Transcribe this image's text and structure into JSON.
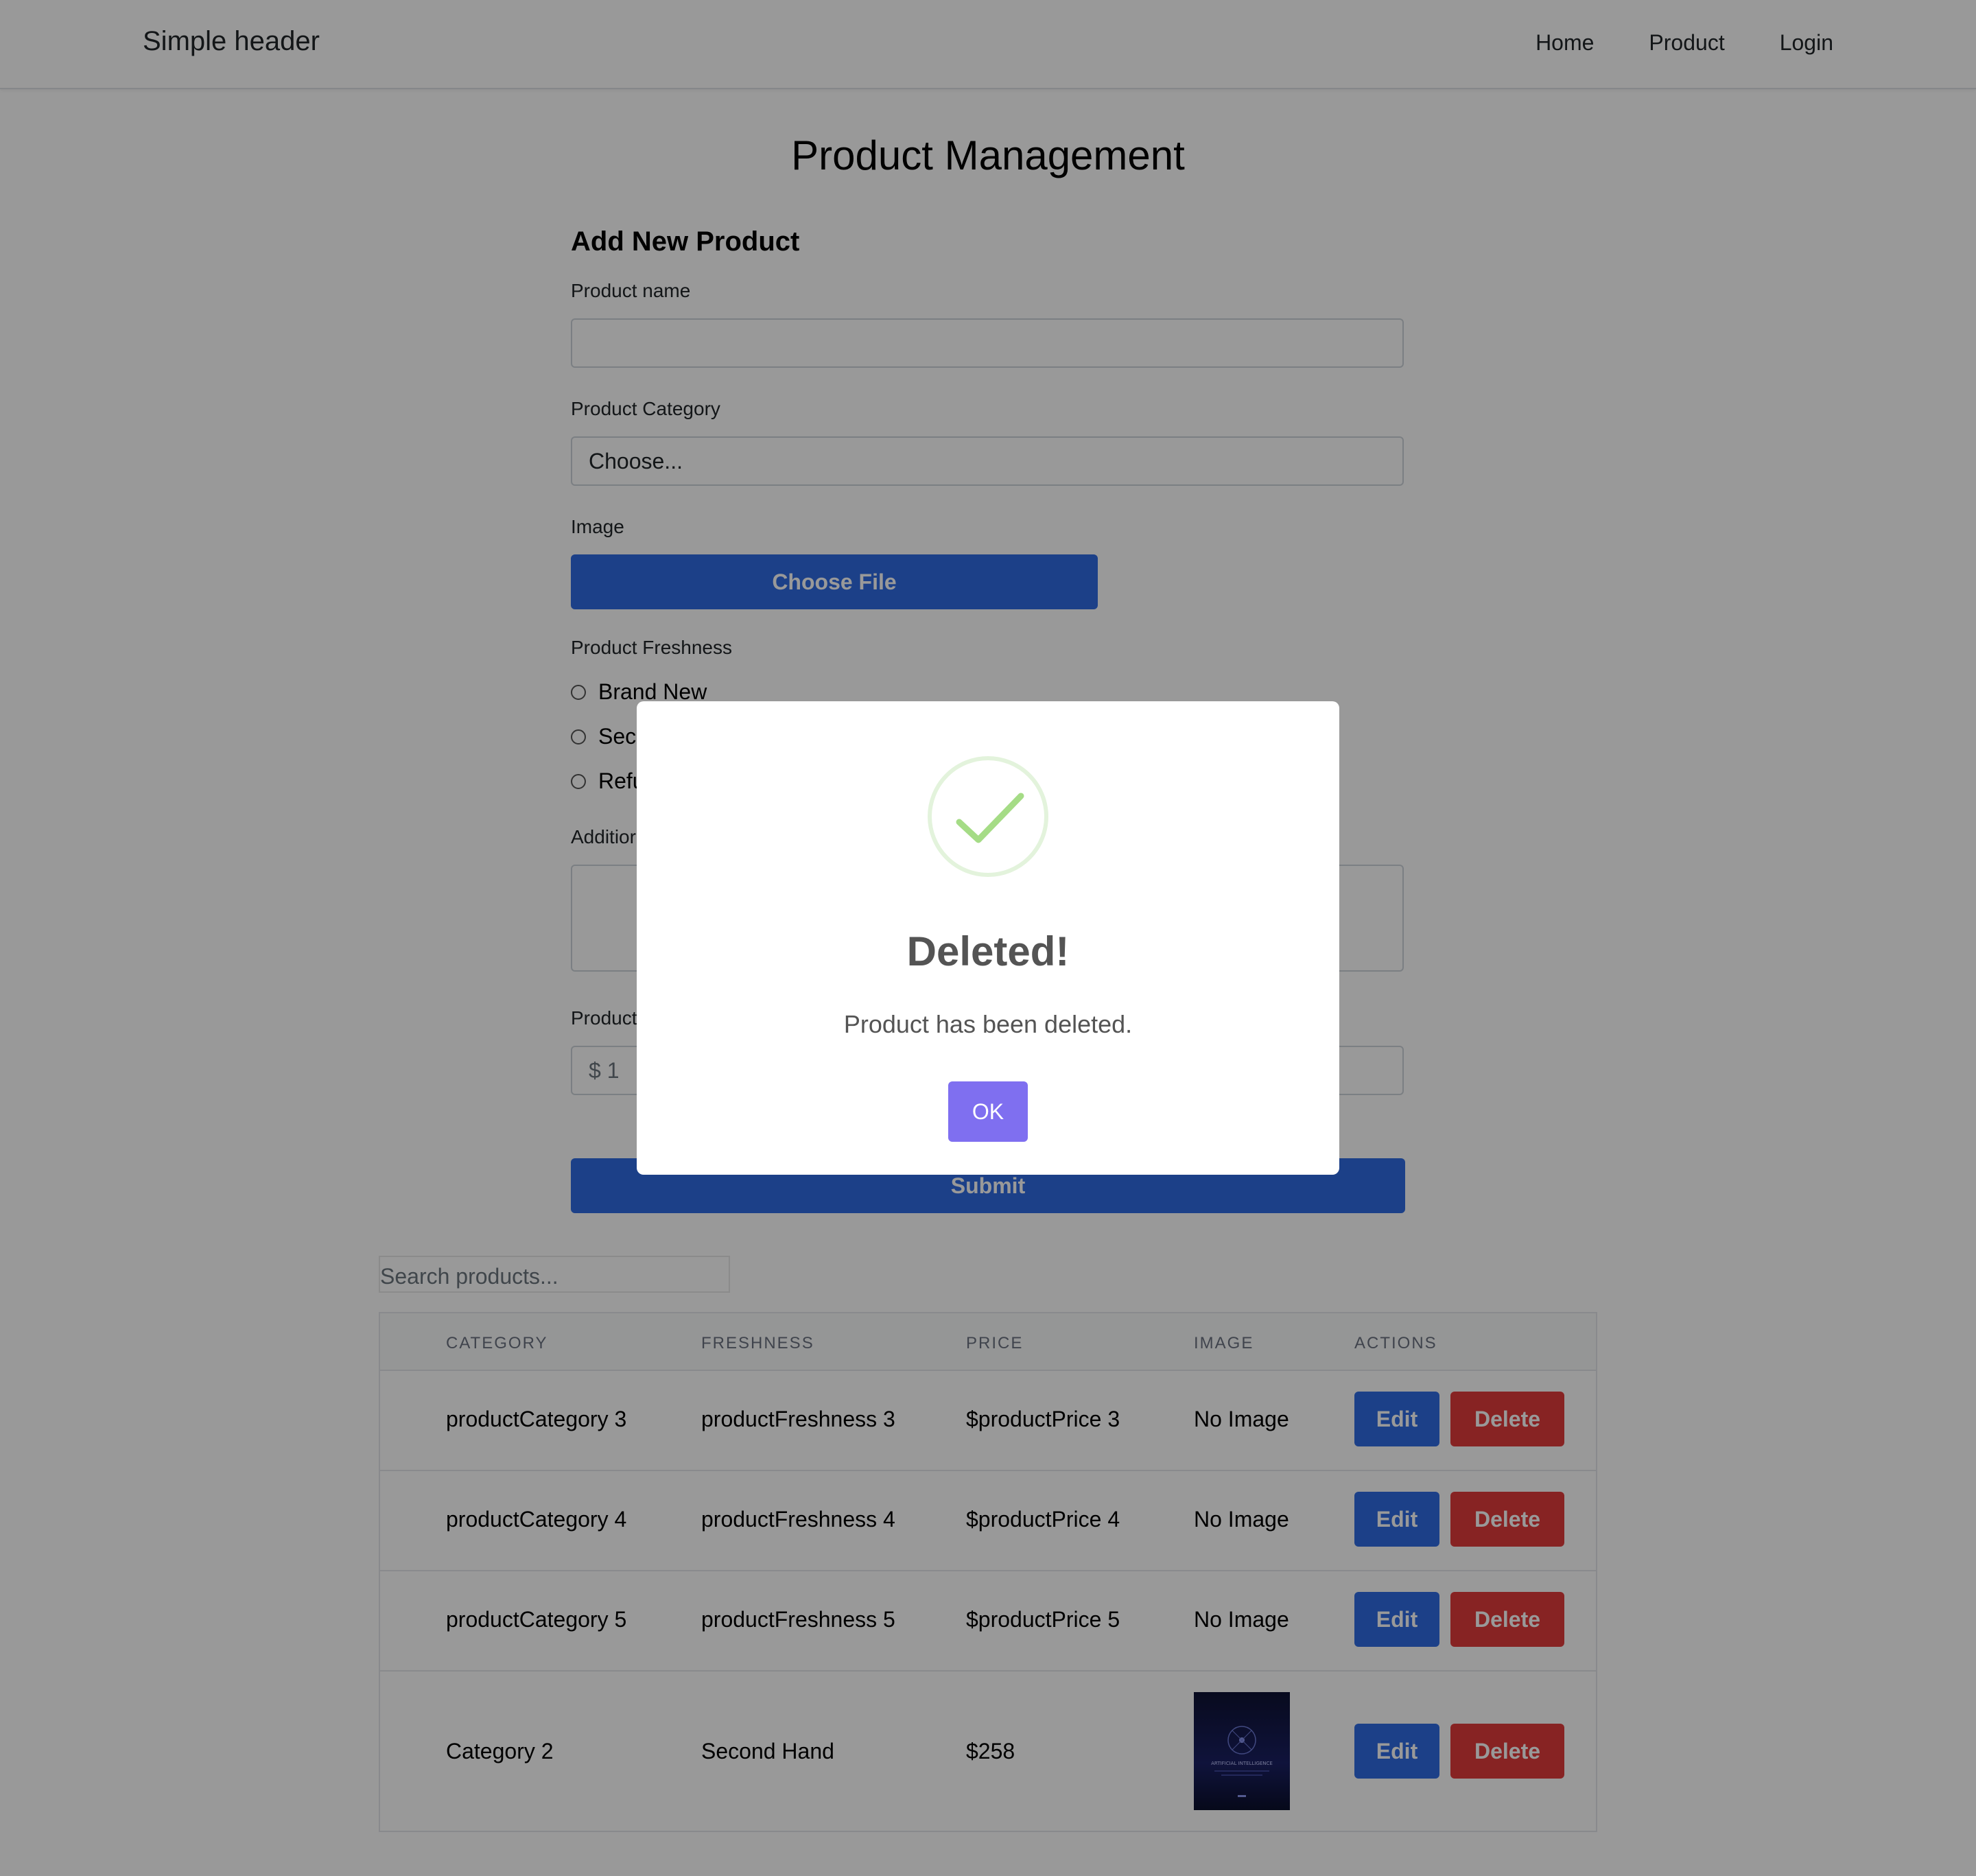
{
  "header": {
    "brand": "Simple header",
    "nav": [
      "Home",
      "Product",
      "Login"
    ]
  },
  "page_title": "Product Management",
  "form": {
    "heading": "Add New Product",
    "product_name_label": "Product name",
    "product_name_value": "",
    "category_label": "Product Category",
    "category_selected": "Choose...",
    "image_label": "Image",
    "choose_file_label": "Choose File",
    "freshness_label": "Product Freshness",
    "freshness_options": [
      "Brand New",
      "Sec",
      "Refu"
    ],
    "additional_label": "Additior",
    "price_label": "Product",
    "price_placeholder": "$ 1",
    "submit_label": "Submit"
  },
  "search": {
    "placeholder": "Search products..."
  },
  "table": {
    "headers": [
      "CATEGORY",
      "FRESHNESS",
      "PRICE",
      "IMAGE",
      "ACTIONS"
    ],
    "rows": [
      {
        "category": "productCategory 3",
        "freshness": "productFreshness 3",
        "price": "$productPrice 3",
        "image": "No Image"
      },
      {
        "category": "productCategory 4",
        "freshness": "productFreshness 4",
        "price": "$productPrice 4",
        "image": "No Image"
      },
      {
        "category": "productCategory 5",
        "freshness": "productFreshness 5",
        "price": "$productPrice 5",
        "image": "No Image"
      },
      {
        "category": "Category 2",
        "freshness": "Second Hand",
        "price": "$258",
        "image": ""
      }
    ],
    "edit_label": "Edit",
    "delete_label": "Delete",
    "thumb_text": "ARTIFICIAL INTELLIGENCE"
  },
  "modal": {
    "title": "Deleted!",
    "text": "Product has been deleted.",
    "ok_label": "OK"
  },
  "colors": {
    "primary": "#2f6be3",
    "danger": "#e23b3b",
    "ok": "#7f6ff0",
    "success": "#a5dc86"
  }
}
